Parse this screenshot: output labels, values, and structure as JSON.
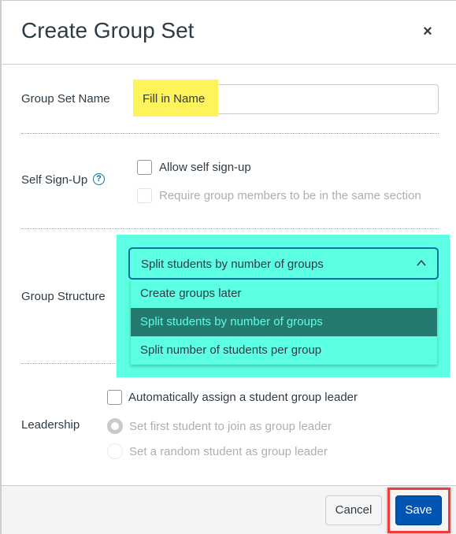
{
  "dialog": {
    "title": "Create Group Set",
    "close_icon": "×"
  },
  "group_set_name": {
    "label": "Group Set Name",
    "value": "Fill in Name",
    "highlight_color": "#fff35c"
  },
  "self_signup": {
    "label": "Self Sign-Up",
    "help_icon": "?",
    "options": [
      {
        "label": "Allow self sign-up",
        "checked": false,
        "disabled": false
      },
      {
        "label": "Require group members to be in the same section",
        "checked": false,
        "disabled": true
      }
    ]
  },
  "group_structure": {
    "label": "Group Structure",
    "selected": "Split students by number of groups",
    "expanded": true,
    "highlight_color": "#5cffe1",
    "options": [
      {
        "label": "Create groups later",
        "selected": false
      },
      {
        "label": "Split students by number of groups",
        "selected": true
      },
      {
        "label": "Split number of students per group",
        "selected": false
      }
    ]
  },
  "leadership": {
    "label": "Leadership",
    "auto_assign": {
      "label": "Automatically assign a student group leader",
      "checked": false
    },
    "options": [
      {
        "label": "Set first student to join as group leader",
        "checked": true,
        "disabled": true
      },
      {
        "label": "Set a random student as group leader",
        "checked": false,
        "disabled": true
      }
    ]
  },
  "footer": {
    "cancel_label": "Cancel",
    "save_label": "Save",
    "save_color": "#0055b3",
    "save_highlight_color": "#f23c3c"
  }
}
